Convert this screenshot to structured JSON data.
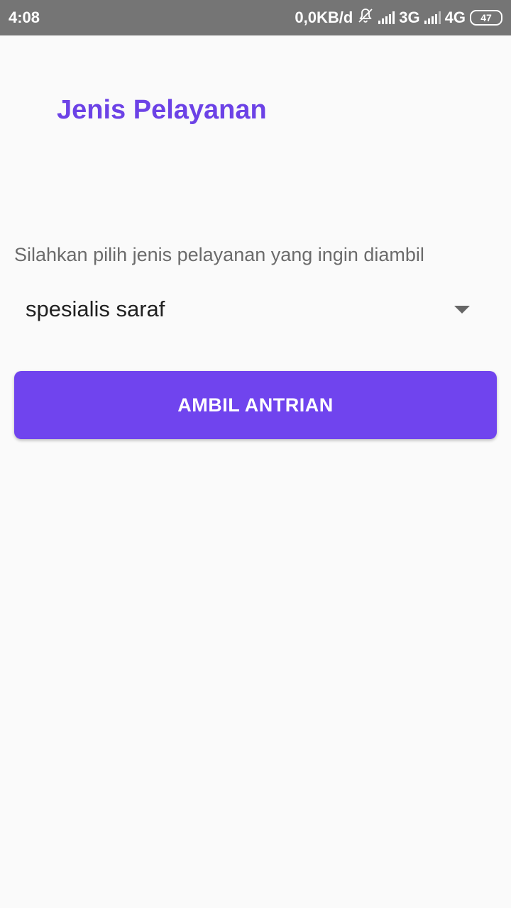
{
  "status_bar": {
    "time": "4:08",
    "data_speed": "0,0KB/d",
    "mute_icon": "muted-bell-icon",
    "network_1": "3G",
    "network_2": "4G",
    "battery": "47"
  },
  "screen": {
    "title": "Jenis Pelayanan",
    "instruction": "Silahkan pilih jenis pelayanan yang ingin diambil",
    "service_select": {
      "selected": "spesialis saraf"
    },
    "submit_label": "AMBIL ANTRIAN"
  },
  "colors": {
    "accent": "#6c42e6",
    "button": "#7044ee",
    "status_bar": "#757575",
    "background": "#fafafa"
  }
}
